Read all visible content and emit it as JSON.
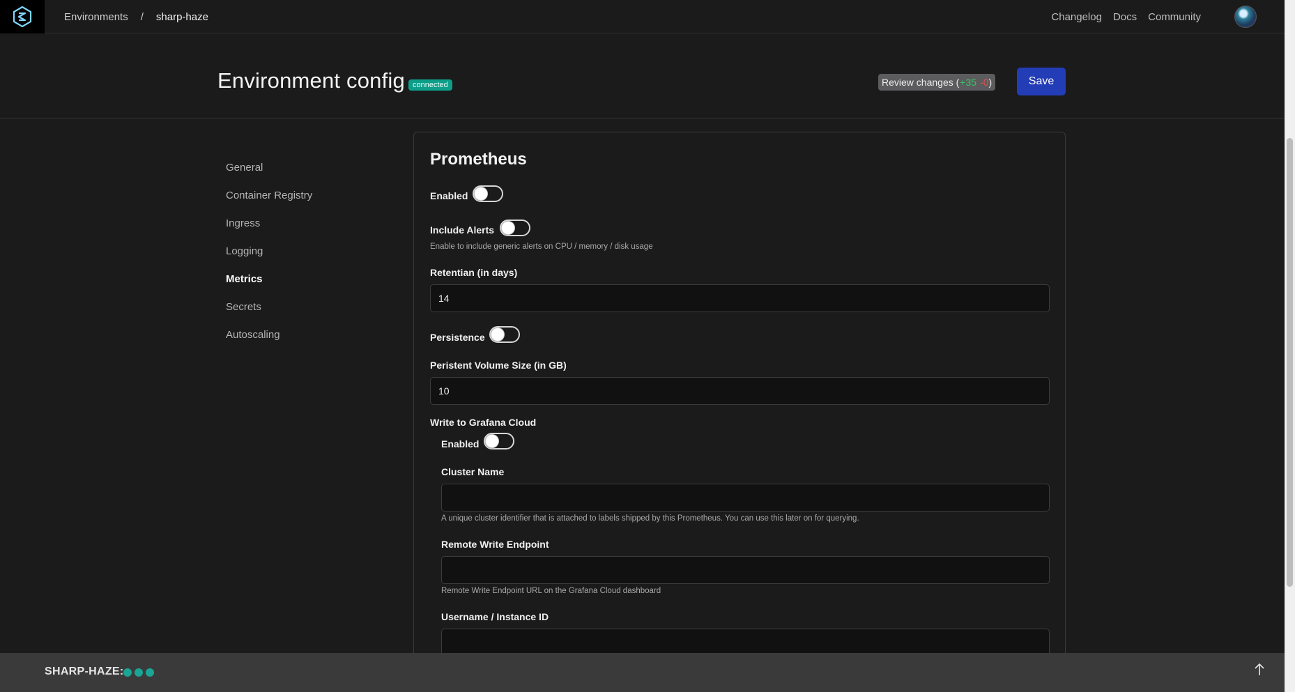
{
  "nav": {
    "breadcrumb_root": "Environments",
    "breadcrumb_sep": "/",
    "breadcrumb_current": "sharp-haze",
    "links": [
      "Changelog",
      "Docs",
      "Community"
    ]
  },
  "header": {
    "title": "Environment config",
    "status": "connected",
    "review_label": "Review changes (",
    "review_plus": "+35",
    "review_minus": "-0",
    "review_close": ")",
    "save_label": "Save"
  },
  "sidebar": {
    "items": [
      {
        "label": "General"
      },
      {
        "label": "Container Registry"
      },
      {
        "label": "Ingress"
      },
      {
        "label": "Logging"
      },
      {
        "label": "Metrics"
      },
      {
        "label": "Secrets"
      },
      {
        "label": "Autoscaling"
      }
    ],
    "active": "Metrics"
  },
  "panel": {
    "title": "Prometheus",
    "enabled_label": "Enabled",
    "include_alerts_label": "Include Alerts",
    "include_alerts_help": "Enable to include generic alerts on CPU / memory / disk usage",
    "retention_label": "Retentian (in days)",
    "retention_value": "14",
    "persistence_label": "Persistence",
    "volume_label": "Peristent Volume Size (in GB)",
    "volume_value": "10",
    "grafana_heading": "Write to Grafana Cloud",
    "grafana_enabled_label": "Enabled",
    "cluster_name_label": "Cluster Name",
    "cluster_name_value": "",
    "cluster_name_help": "A unique cluster identifier that is attached to labels shipped by this Prometheus. You can use this later on for querying.",
    "remote_write_label": "Remote Write Endpoint",
    "remote_write_value": "",
    "remote_write_help": "Remote Write Endpoint URL on the Grafana Cloud dashboard",
    "username_label": "Username / Instance ID",
    "username_value": ""
  },
  "footer": {
    "label": "SHARP-HAZE:",
    "dot_color": "#1aa595"
  },
  "colors": {
    "accent": "#233db6",
    "badge": "#0d9e8a"
  }
}
